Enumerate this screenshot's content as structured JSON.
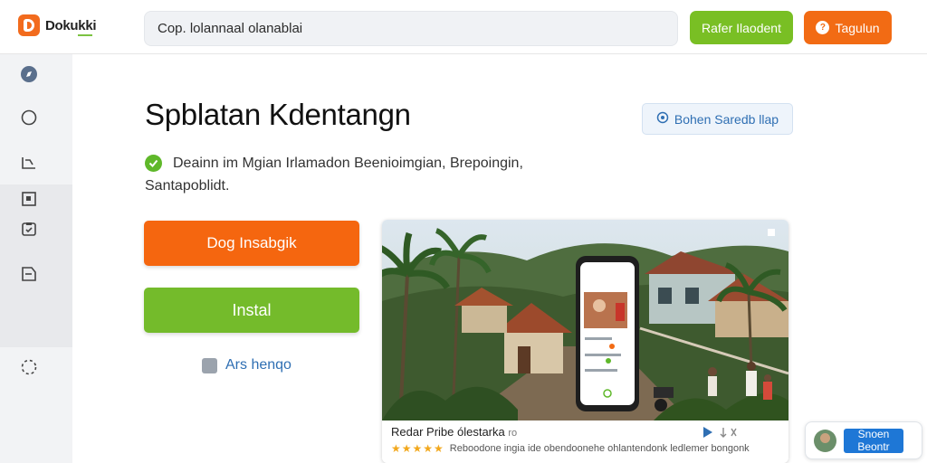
{
  "brand": {
    "name": "Dokukki"
  },
  "search": {
    "value": "Cop. lolannaal olanablai"
  },
  "header": {
    "green_button": "Rafer Ilaodent",
    "orange_button": "Tagulun"
  },
  "main": {
    "title": "Spblatan Kdentangn",
    "help_button": "Bohen Saredb llap",
    "description_line1": "Deainn im Mgian Irlamadon Beenioimgian, Brepoingin,",
    "description_line2": "Santapoblidt.",
    "primary_button": "Dog Insabgik",
    "install_button": "Instal",
    "checkbox_label": "Ars henqo"
  },
  "media_card": {
    "caption_title": "Redar Pribe ólestarka",
    "caption_suffix": "ro",
    "rating_stars": 5,
    "caption_text": "Reboodone ingia ide obendoonehe ohlantendonk ledlemer bongonk"
  },
  "chat_widget": {
    "button": "Snoen Beontr"
  },
  "colors": {
    "accent_orange": "#f5660f",
    "accent_green": "#74bb2b",
    "link_blue": "#2f6fb3",
    "sidebar_bg": "#f2f3f5"
  },
  "icons": [
    "logo-icon",
    "compass-icon",
    "circle-icon",
    "chart-icon",
    "square-icon",
    "clipboard-icon",
    "tag-icon",
    "loading-icon",
    "check-icon",
    "help-icon",
    "play-icon"
  ]
}
